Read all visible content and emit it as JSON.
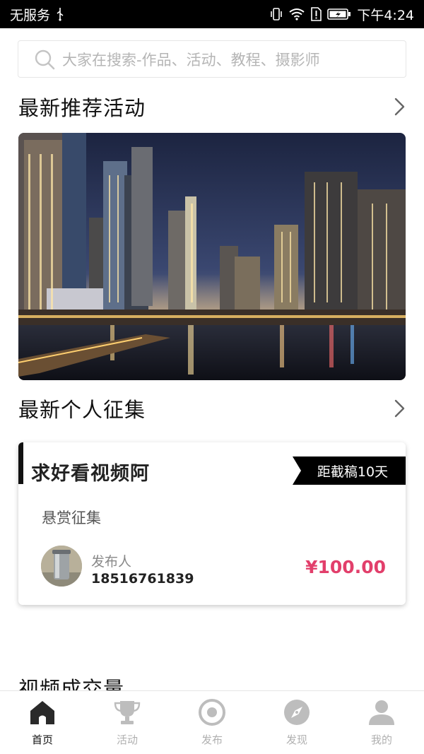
{
  "status_bar": {
    "carrier": "无服务",
    "time": "下午4:24",
    "icons": [
      "usb-icon",
      "vibrate-icon",
      "wifi-icon",
      "sim-alert-icon",
      "battery-charging-icon"
    ]
  },
  "search": {
    "placeholder": "大家在搜索-作品、活动、教程、摄影师",
    "icon": "search-icon"
  },
  "sections": {
    "recommended_activities": {
      "title": "最新推荐活动"
    },
    "personal_collection": {
      "title": "最新个人征集"
    },
    "video_deals": {
      "title": "视频成交量"
    }
  },
  "banner": {
    "image": "city-night-skyline-photo"
  },
  "collection_card": {
    "title": "求好看视频阿",
    "deadline": "距截稿10天",
    "subtitle": "悬赏征集",
    "publisher_label": "发布人",
    "publisher_phone": "18516761839",
    "price": "¥100.00"
  },
  "colors": {
    "price": "#e23f6b",
    "nav_active": "#111111",
    "nav_inactive": "#b0b0b0"
  },
  "bottom_nav": {
    "items": [
      {
        "label": "首页",
        "icon": "home-icon",
        "active": true
      },
      {
        "label": "活动",
        "icon": "trophy-icon",
        "active": false
      },
      {
        "label": "发布",
        "icon": "publish-icon",
        "active": false
      },
      {
        "label": "发现",
        "icon": "compass-icon",
        "active": false
      },
      {
        "label": "我的",
        "icon": "profile-icon",
        "active": false
      }
    ]
  }
}
